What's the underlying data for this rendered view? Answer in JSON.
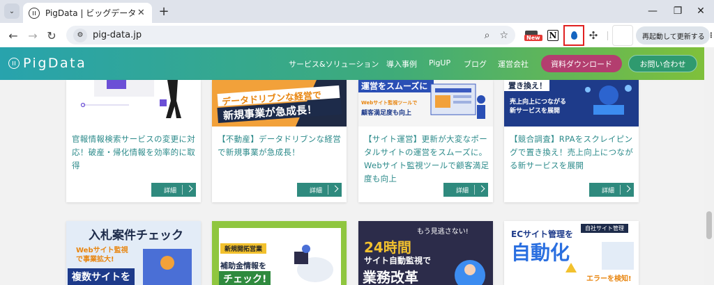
{
  "browser": {
    "tab_title": "PigData | ビッグデータ収集・分析・活用",
    "tab_close": "✕",
    "new_tab": "+",
    "url": "pig-data.jp",
    "new_badge": "New",
    "notion_letter": "N",
    "update_label": "再起動して更新する",
    "menu_dots": "⋮"
  },
  "site": {
    "logo": "PigData",
    "nav": [
      "サービス&ソリューション",
      "導入事例",
      "PigUP",
      "ブログ",
      "運営会社"
    ],
    "download_label": "資料ダウンロード",
    "contact_label": "お問い合わせ"
  },
  "cards": [
    {
      "title": "官報情報検索サービスの変更に対応！破産・帰化情報を効率的に取得",
      "button": "詳細"
    },
    {
      "image_headline_1": "データドリブンな経営で",
      "image_headline_2": "新規事業が急成長！",
      "title": "【不動産】データドリブンな経営で新規事業が急成長！",
      "button": "詳細"
    },
    {
      "image_headline_1": "運営をスムーズに",
      "image_sub": "Webサイト監視ツールで",
      "image_headline_2": "顧客満足度も向上",
      "title": "【サイト運営】更新が大変なポータルサイトの運営をスムーズに。Webサイト監視ツールで顧客満足度も向上",
      "button": "詳細"
    },
    {
      "image_headline_1": "置き換え！",
      "image_sub": "売上向上につながる",
      "image_headline_2": "新サービスを展開",
      "title": "【競合調査】RPAをスクレイピングで置き換え！売上向上につながる新サービスを展開",
      "button": "詳細"
    }
  ],
  "cards_row2": [
    {
      "headline": "入札案件チェック",
      "sub": "Webサイト監視で事業拡大!",
      "bottom": "複数サイトを"
    },
    {
      "tag": "新規開拓営業",
      "line1": "補助金情報を",
      "line2": "チェック!"
    },
    {
      "badge": "もう見逃さない!",
      "big": "24時間",
      "line1": "サイト自動監視で",
      "line2": "業務改革"
    },
    {
      "tag": "自社サイト管理",
      "line1": "ECサイト管理を",
      "line2": "自動化",
      "alert": "エラーを検知!"
    }
  ],
  "colors": {
    "header_start": "#28a3ad",
    "header_end": "#7fc03b",
    "download_btn": "#b33e6f",
    "contact_btn": "#2f9a6f",
    "card_text": "#2b8a8a",
    "detail_btn": "#2f8a7e",
    "highlight_box": "#e02020"
  },
  "icons": [
    "tab-list-icon",
    "back-arrow-icon",
    "forward-arrow-icon",
    "reload-icon",
    "site-info-icon",
    "zoom-icon",
    "bookmark-star-icon",
    "puzzle-icon",
    "drop-icon"
  ]
}
